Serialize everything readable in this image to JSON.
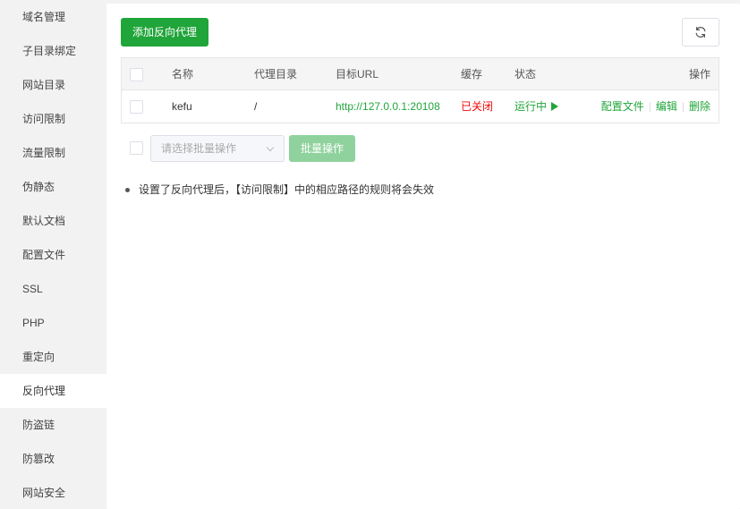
{
  "sidebar": {
    "items": [
      {
        "label": "域名管理"
      },
      {
        "label": "子目录绑定"
      },
      {
        "label": "网站目录"
      },
      {
        "label": "访问限制"
      },
      {
        "label": "流量限制"
      },
      {
        "label": "伪静态"
      },
      {
        "label": "默认文档"
      },
      {
        "label": "配置文件"
      },
      {
        "label": "SSL"
      },
      {
        "label": "PHP"
      },
      {
        "label": "重定向"
      },
      {
        "label": "反向代理",
        "active": true
      },
      {
        "label": "防盗链"
      },
      {
        "label": "防篡改"
      },
      {
        "label": "网站安全"
      }
    ]
  },
  "toolbar": {
    "add_label": "添加反向代理",
    "refresh_icon": "refresh-icon"
  },
  "table": {
    "headers": {
      "name": "名称",
      "dir": "代理目录",
      "url": "目标URL",
      "cache": "缓存",
      "status": "状态",
      "actions": "操作"
    },
    "rows": [
      {
        "name": "kefu",
        "dir": "/",
        "url": "http://127.0.0.1:20108",
        "cache": "已关闭",
        "status": "运行中",
        "action_config": "配置文件",
        "action_edit": "编辑",
        "action_delete": "删除"
      }
    ]
  },
  "batch": {
    "select_placeholder": "请选择批量操作",
    "button_label": "批量操作"
  },
  "notes": [
    "设置了反向代理后，【访问限制】中的相应路径的规则将会失效"
  ],
  "colors": {
    "accent": "#20a53a",
    "danger": "#ef0808"
  }
}
